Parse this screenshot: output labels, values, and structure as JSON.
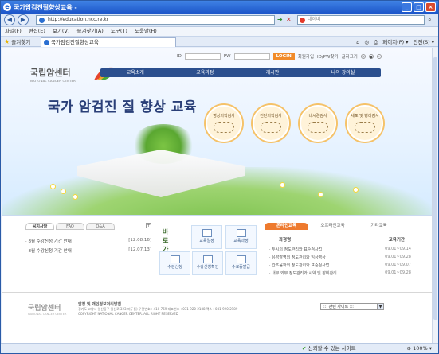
{
  "window": {
    "title": "국가암검진질향상교육 -"
  },
  "browser": {
    "url": "http://education.ncc.re.kr",
    "search_placeholder": "네이버",
    "tab_title": "국가암검진질향상교육",
    "favorites": "즐겨찾기",
    "menu": [
      "파일(F)",
      "편집(E)",
      "보기(V)",
      "즐겨찾기(A)",
      "도구(T)",
      "도움말(H)"
    ],
    "tools": [
      "페이지(P) ▾",
      "안전(S) ▾"
    ],
    "zone": "신뢰할 수 있는 사이트",
    "zoom": "100%"
  },
  "site": {
    "login": {
      "id": "ID",
      "pw": "PW",
      "btn": "LOGIN",
      "join": "회원가입",
      "find": "ID/PW찾기",
      "font": "글자크기"
    },
    "logo": {
      "name": "국립암센터",
      "sub": "NATIONAL CANCER CENTER"
    },
    "nav": [
      "교육소개",
      "교육과정",
      "게시판",
      "나의 강의실"
    ],
    "headline": "국가 암검진 질 향상 교육",
    "circles": [
      "영상의학검사",
      "진단의학검사",
      "내시경검사",
      "세포 및 병리검사"
    ]
  },
  "notice": {
    "tabs": [
      "공지사항",
      "FAQ",
      "Q&A"
    ],
    "items": [
      {
        "t": "· 8월 수강신청 기간 안내",
        "d": "[12.08.16]"
      },
      {
        "t": "· 8월 수강신청 기간 안내",
        "d": "[12.07.13]"
      }
    ]
  },
  "quick": {
    "deco": "바로가기",
    "buttons": [
      "교육일정",
      "교육과정",
      "수강신청",
      "수강신청확인",
      "수료증발급"
    ]
  },
  "online": {
    "tabs": [
      "온라인교육",
      "오프라인교육",
      "기타교육"
    ],
    "col1": "과정명",
    "col2": "교육기간",
    "rows": [
      {
        "n": "· 투시의 정도관리와 표준검사법",
        "d": "09.01~09.14"
      },
      {
        "n": "· 유방촬영의 정도관리와 임상영상",
        "d": "09.01~09.28"
      },
      {
        "n": "· 간초음파의 정도관리와 표준검사법",
        "d": "09.01~09.07"
      },
      {
        "n": "· 내부 외부 정도관리와 시약 및 장비관리",
        "d": "09.01~09.28"
      }
    ]
  },
  "footer": {
    "logo": "국립암센터",
    "logo_en": "NATIONAL CANCER CENTER",
    "title": "암정 및 개인정보처리방침",
    "addr": "경기도 고양시 일산동구 일산로 323(마두동) 우편번호 : 410-769  대표번호 : 031-920-2188  팩스 : 031-920-2189",
    "copy": "COPYRIGHT NATIONAL CANCER CENTER. ALL RIGHT RESERVED",
    "select": "::: 관련 사이트 :::"
  }
}
